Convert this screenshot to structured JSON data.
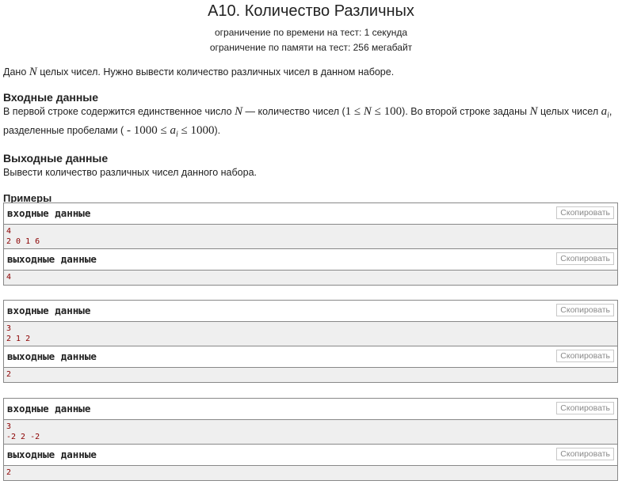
{
  "problem": {
    "title": "A10. Количество Различных",
    "time_limit": "ограничение по времени на тест: 1 секунда",
    "memory_limit": "ограничение по памяти на тест: 256 мегабайт"
  },
  "statement": {
    "p1_a": "Дано ",
    "p1_N": "N",
    "p1_b": " целых чисел. Нужно вывести количество различных чисел в данном наборе."
  },
  "input_section": {
    "title": "Входные данные",
    "t1": "В первой строке содержится единственное число ",
    "N1": "N",
    "t2": " — количество чисел (",
    "c1": "1 ≤ ",
    "N2": "N",
    "c2": " ≤ 100",
    "t3": "). Во второй строке заданы ",
    "N3": "N",
    "t4": " целых чисел ",
    "a1": "a",
    "i1": "i",
    "t5": ",",
    "t6": "разделенные пробелами (",
    "c3": " - 1000 ≤ ",
    "a2": "a",
    "i2": "i",
    "c4": " ≤ 1000",
    "t7": ")."
  },
  "output_section": {
    "title": "Выходные данные",
    "text": "Вывести количество различных чисел данного набора."
  },
  "examples": {
    "title": "Примеры",
    "input_label": "входные данные",
    "output_label": "выходные данные",
    "copy_label": "Скопировать",
    "list": [
      {
        "input": [
          "4",
          "2 0 1 6"
        ],
        "output": [
          "4"
        ]
      },
      {
        "input": [
          "3",
          "2 1 2"
        ],
        "output": [
          "2"
        ]
      },
      {
        "input": [
          "3",
          "-2 2 -2"
        ],
        "output": [
          "2"
        ]
      }
    ]
  }
}
